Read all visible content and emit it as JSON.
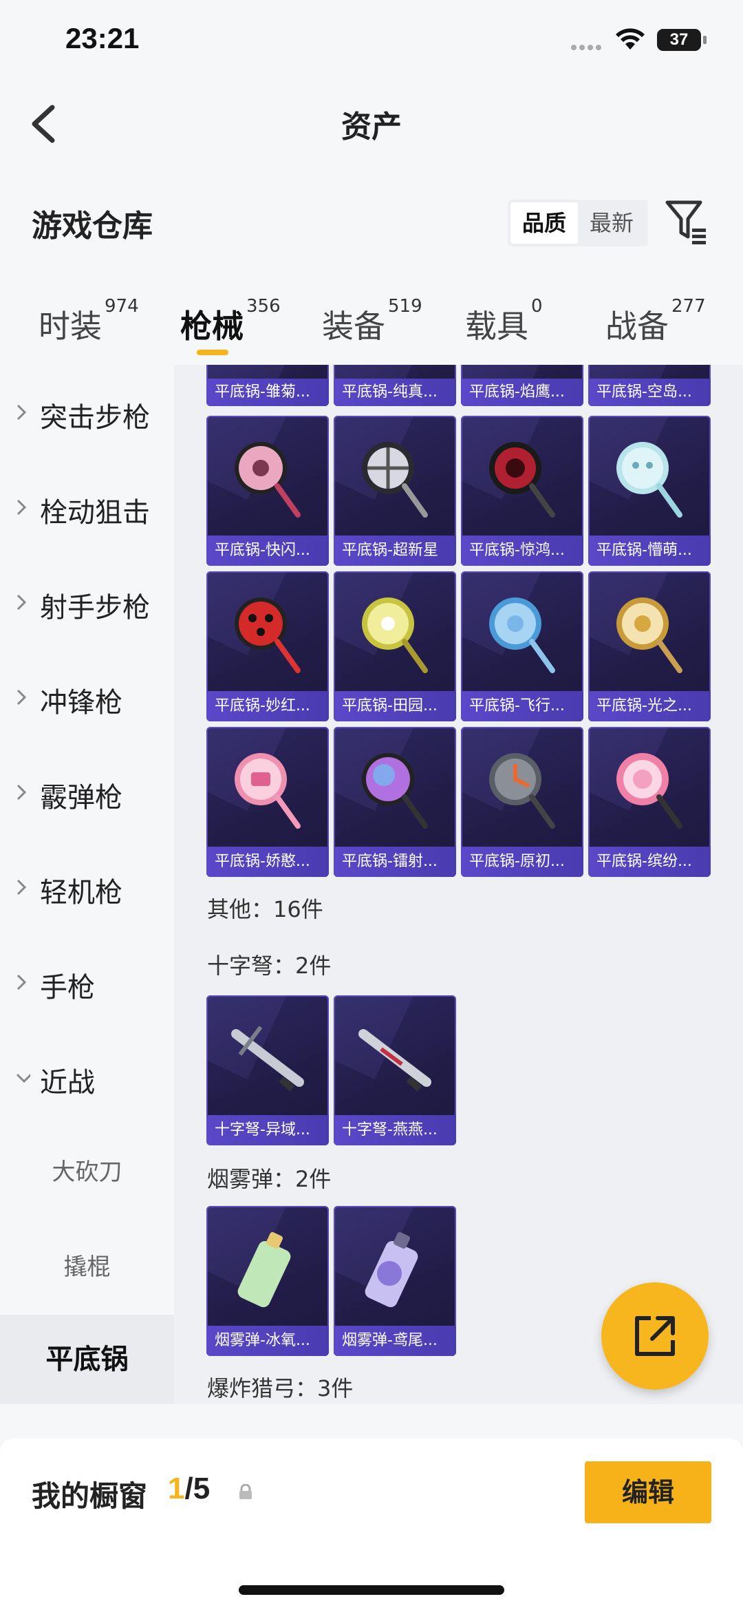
{
  "status": {
    "time": "23:21",
    "battery": "37"
  },
  "nav": {
    "title": "资产"
  },
  "header": {
    "heading": "游戏仓库",
    "sort_options": [
      "品质",
      "最新"
    ],
    "sort_active": "品质"
  },
  "tabs": [
    {
      "label": "时装",
      "count": "974"
    },
    {
      "label": "枪械",
      "count": "356",
      "active": true
    },
    {
      "label": "装备",
      "count": "519"
    },
    {
      "label": "载具",
      "count": "0"
    },
    {
      "label": "战备",
      "count": "277"
    }
  ],
  "sidebar": {
    "categories": [
      "突击步枪",
      "栓动狙击",
      "射手步枪",
      "冲锋枪",
      "霰弹枪",
      "轻机枪",
      "手枪",
      "近战"
    ],
    "subitems": [
      "大砍刀",
      "撬棍"
    ],
    "selected": "平底锅"
  },
  "content": {
    "top_row": [
      "平底锅-雏菊...",
      "平底锅-纯真...",
      "平底锅-焰鹰...",
      "平底锅-空岛..."
    ],
    "pans": [
      [
        "平底锅-快闪...",
        "平底锅-超新星",
        "平底锅-惊鸿...",
        "平底锅-懵萌..."
      ],
      [
        "平底锅-妙红...",
        "平底锅-田园...",
        "平底锅-飞行...",
        "平底锅-光之..."
      ],
      [
        "平底锅-娇憨...",
        "平底锅-镭射...",
        "平底锅-原初...",
        "平底锅-缤纷..."
      ]
    ],
    "other_label": "其他：16件",
    "crossbow_label": "十字弩：2件",
    "crossbows": [
      "十字弩-异域...",
      "十字弩-燕燕..."
    ],
    "smoke_label": "烟雾弹：2件",
    "smokes": [
      "烟雾弹-冰氧...",
      "烟雾弹-鸢尾..."
    ],
    "bow_label": "爆炸猎弓：3件"
  },
  "bottom": {
    "label": "我的橱窗",
    "current": "1",
    "total": "/5",
    "edit_label": "编辑"
  },
  "colors": {
    "accent": "#f5b41b",
    "card_bg": "#221d48",
    "caption": "#5a48c9"
  },
  "icons": [
    "back-icon",
    "filter-icon",
    "chevron-right-icon",
    "chevron-down-icon",
    "share-icon",
    "lock-icon",
    "wifi-icon"
  ]
}
